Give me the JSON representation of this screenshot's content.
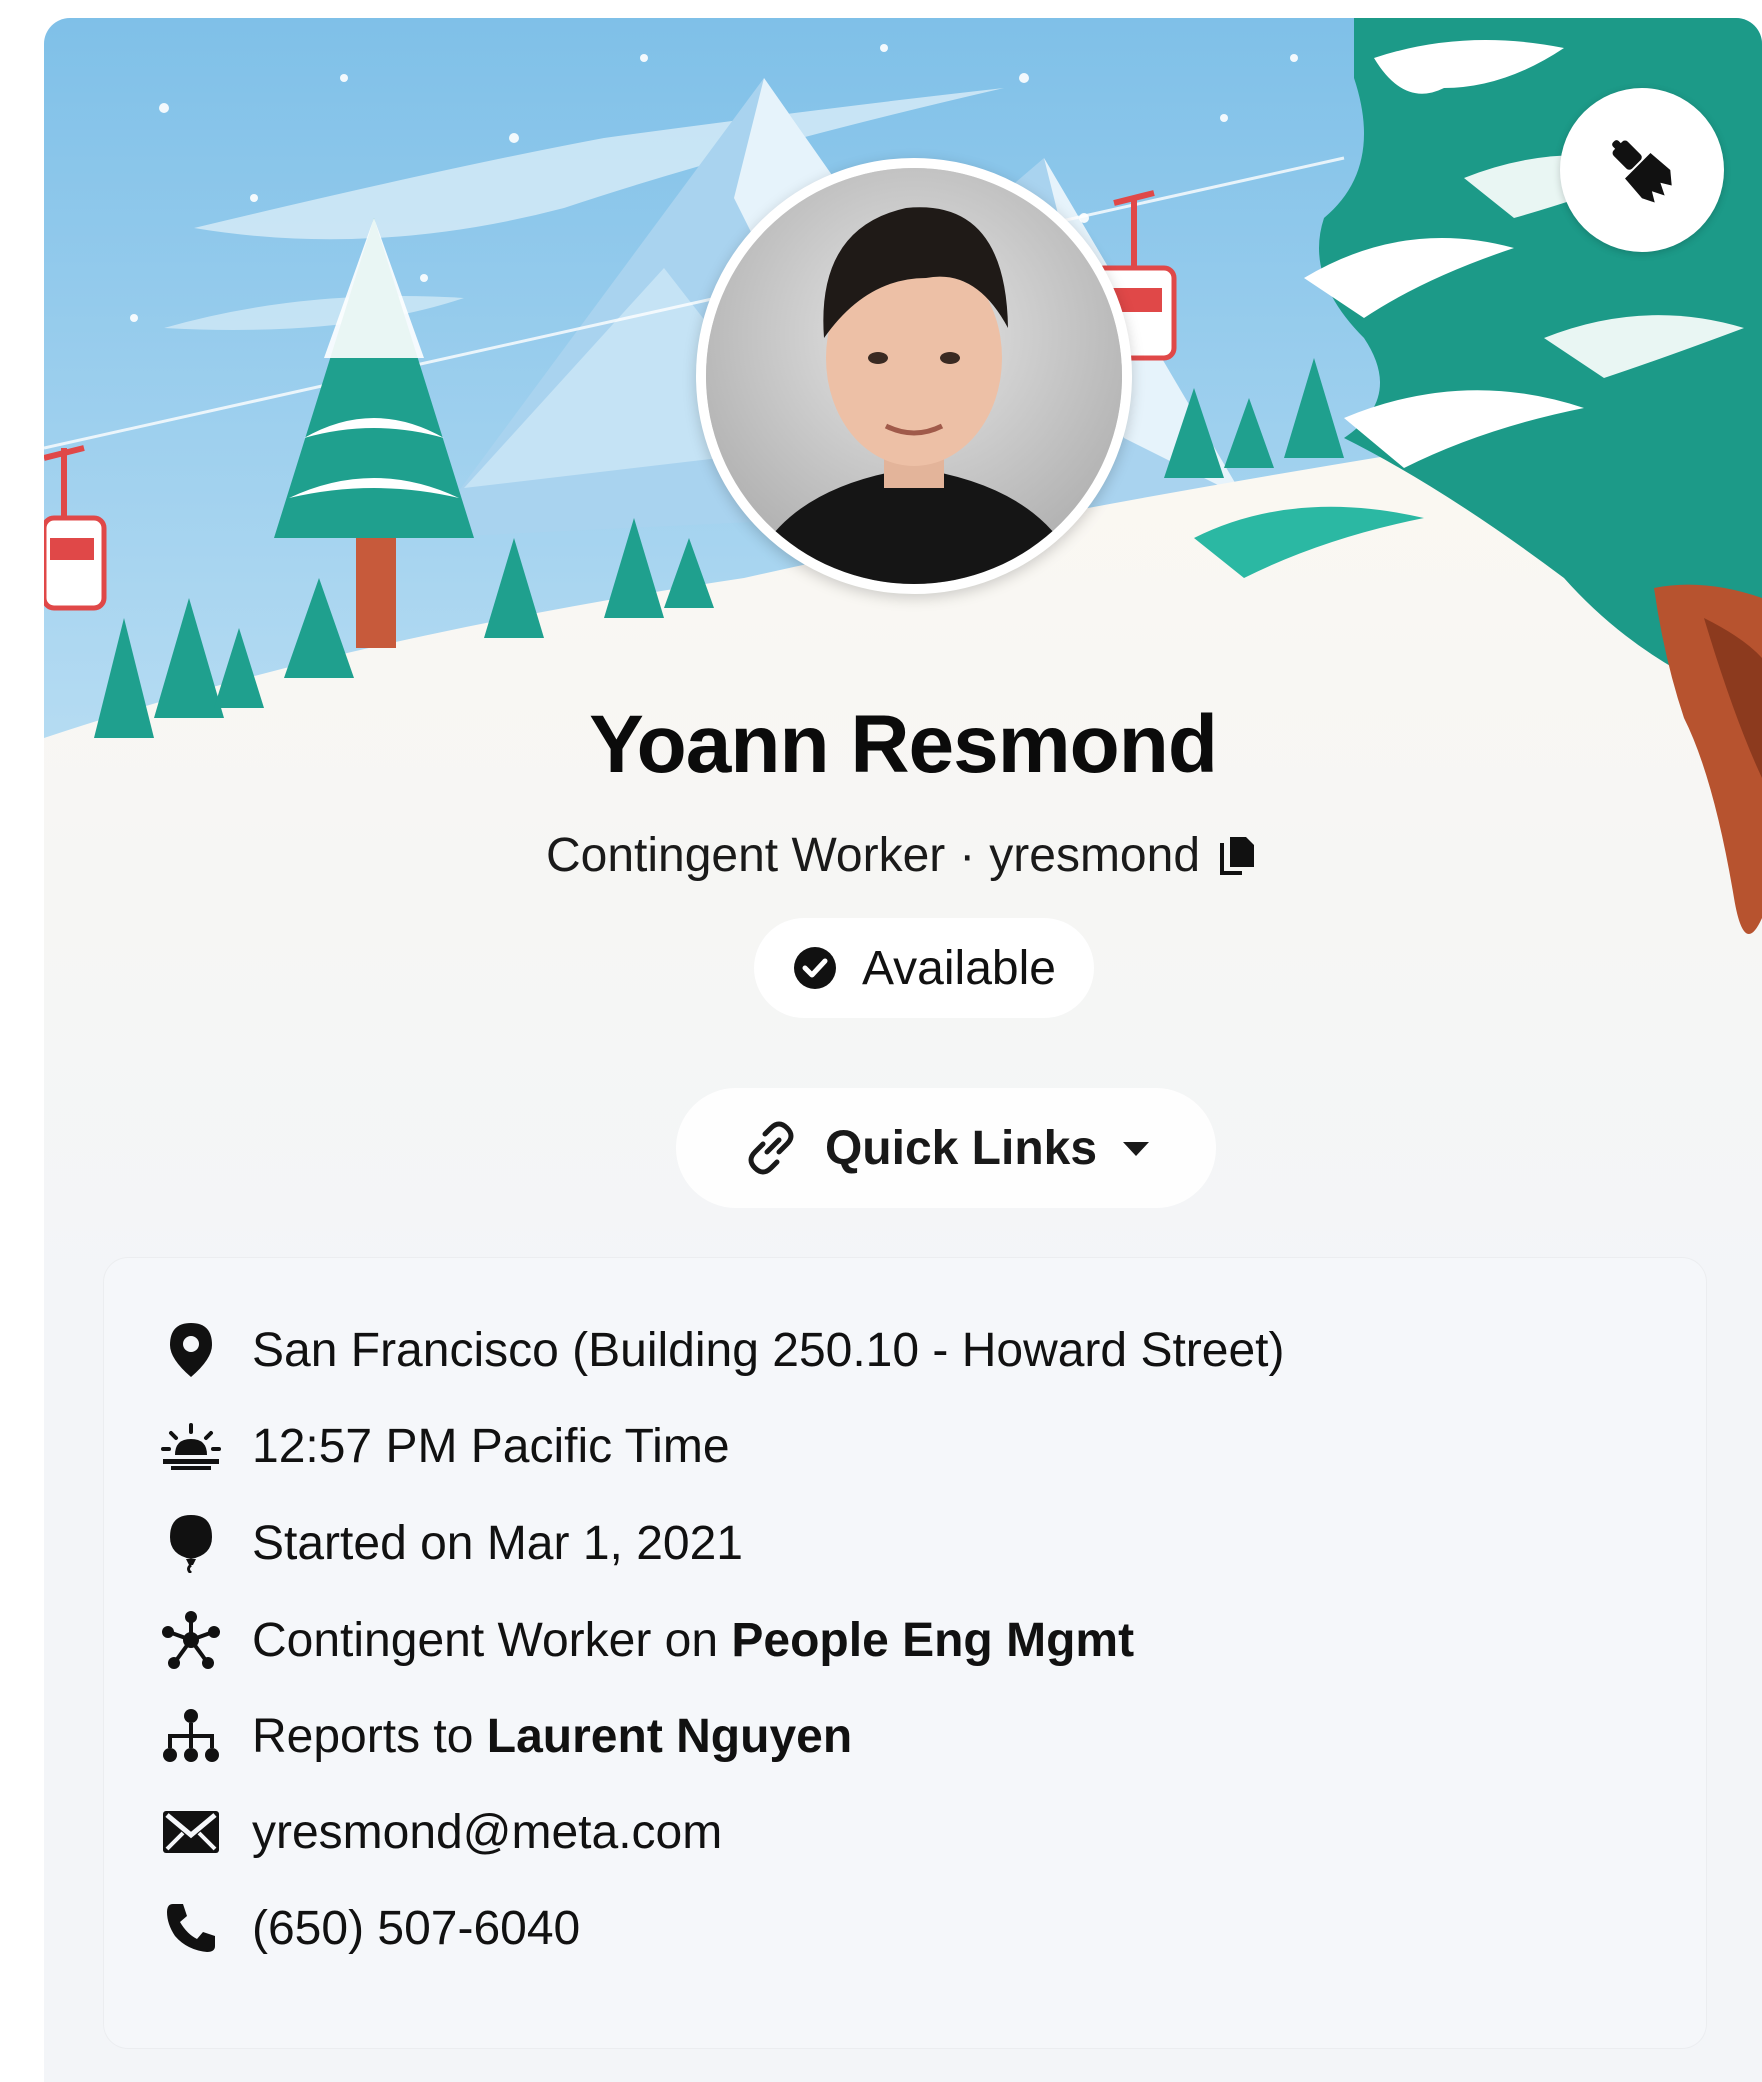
{
  "profile": {
    "name": "Yoann Resmond",
    "role": "Contingent Worker",
    "separator": "·",
    "username": "yresmond",
    "status": "Available",
    "quick_links_label": "Quick Links"
  },
  "details": {
    "location": "San Francisco (Building 250.10 - Howard Street)",
    "local_time": "12:57 PM Pacific Time",
    "start_date": "Started on Mar 1, 2021",
    "team_prefix": "Contingent Worker on ",
    "team_name": "People Eng Mgmt",
    "reports_prefix": "Reports to ",
    "manager_name": "Laurent Nguyen",
    "email": "yresmond@meta.com",
    "phone": "(650) 507-6040"
  },
  "icons": {
    "banner_edit": "paintbrush-icon",
    "copy": "copy-icon",
    "status": "check-circle-icon",
    "quick_links": "link-icon",
    "dropdown": "caret-down-icon",
    "location": "map-pin-icon",
    "time": "sunrise-icon",
    "start": "balloon-icon",
    "team": "team-network-icon",
    "reports": "org-chart-icon",
    "email": "envelope-icon",
    "phone": "phone-icon"
  },
  "colors": {
    "card_background": "#f3f5f8",
    "sky": "#8cc7ea",
    "tree": "#1fa08e",
    "snow": "#fbf8f2",
    "text": "#111111"
  }
}
